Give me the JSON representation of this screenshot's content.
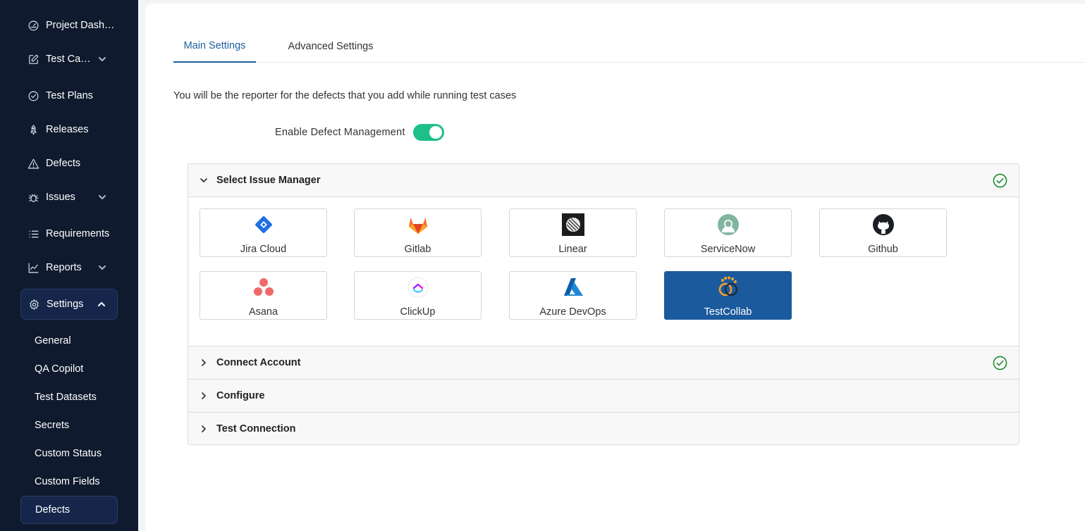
{
  "sidebar": {
    "nav": [
      {
        "label": "Project Dashboard",
        "icon": "dashboard-gauge-icon"
      },
      {
        "label": "Test Cases",
        "icon": "edit-square-icon",
        "expandable": true
      },
      {
        "label": "Test Plans",
        "icon": "check-circle-icon"
      },
      {
        "label": "Releases",
        "icon": "rocket-icon"
      },
      {
        "label": "Defects",
        "icon": "warning-triangle-icon"
      },
      {
        "label": "Issues",
        "icon": "bug-icon",
        "expandable": true
      },
      {
        "label": "Requirements",
        "icon": "list-icon"
      },
      {
        "label": "Reports",
        "icon": "line-chart-icon",
        "expandable": true
      },
      {
        "label": "Settings",
        "icon": "gear-icon",
        "expanded": true,
        "active": true
      }
    ],
    "settings_sub": [
      {
        "label": "General"
      },
      {
        "label": "QA Copilot"
      },
      {
        "label": "Test Datasets"
      },
      {
        "label": "Secrets"
      },
      {
        "label": "Custom Status"
      },
      {
        "label": "Custom Fields"
      },
      {
        "label": "Defects",
        "active": true
      }
    ]
  },
  "tabs": [
    {
      "label": "Main Settings",
      "active": true
    },
    {
      "label": "Advanced Settings",
      "active": false
    }
  ],
  "reporter_note": "You will be the reporter for the defects that you add while running test cases",
  "defect_toggle": {
    "label": "Enable Defect Management",
    "enabled": true
  },
  "accordion": {
    "sections": [
      {
        "title": "Select Issue Manager",
        "expanded": true,
        "completed": true
      },
      {
        "title": "Connect Account",
        "expanded": false,
        "completed": true
      },
      {
        "title": "Configure",
        "expanded": false,
        "completed": false
      },
      {
        "title": "Test Connection",
        "expanded": false,
        "completed": false
      }
    ],
    "issue_managers": [
      {
        "name": "Jira Cloud",
        "icon": "jira-logo-icon"
      },
      {
        "name": "Gitlab",
        "icon": "gitlab-logo-icon"
      },
      {
        "name": "Linear",
        "icon": "linear-logo-icon"
      },
      {
        "name": "ServiceNow",
        "icon": "servicenow-logo-icon"
      },
      {
        "name": "Github",
        "icon": "github-logo-icon"
      },
      {
        "name": "Asana",
        "icon": "asana-logo-icon"
      },
      {
        "name": "ClickUp",
        "icon": "clickup-logo-icon"
      },
      {
        "name": "Azure DevOps",
        "icon": "azure-devops-logo-icon"
      },
      {
        "name": "TestCollab",
        "icon": "testcollab-logo-icon",
        "selected": true
      }
    ]
  },
  "colors": {
    "sidebar_bg": "#0f1a2e",
    "sidebar_active": "#15264a",
    "accent": "#1f5e9e",
    "toggle_on": "#1fbf8a",
    "success": "#1a8a2e",
    "selected_card": "#1c5a9e"
  }
}
